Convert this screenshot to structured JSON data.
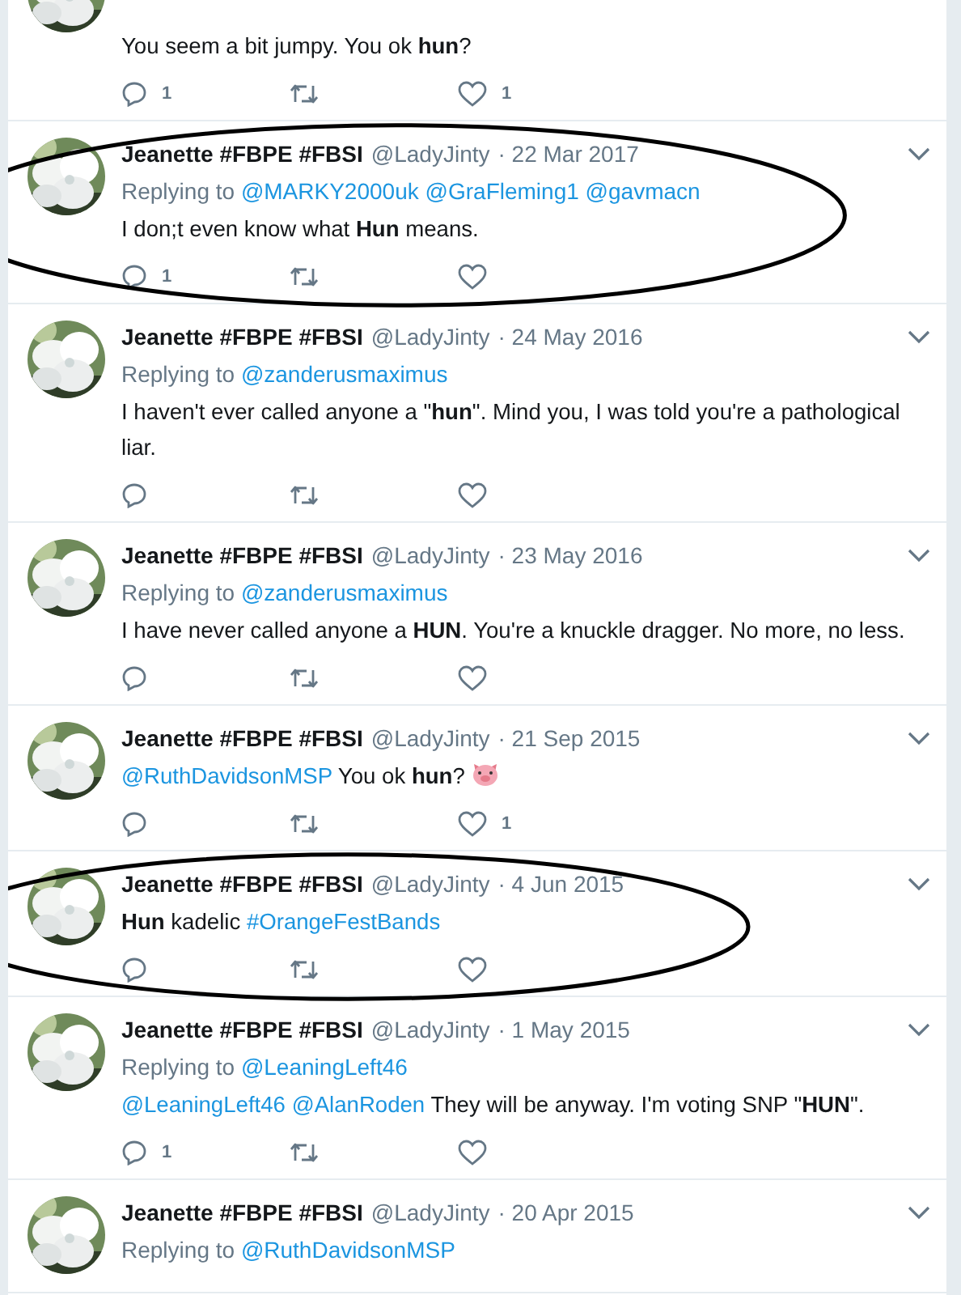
{
  "tweets": [
    {
      "partial": true,
      "circled": false,
      "body": [
        {
          "kind": "text",
          "text": "You seem a bit jumpy. You ok **hun**?"
        }
      ],
      "replies": "1",
      "likes": "1"
    },
    {
      "partial": false,
      "circled": true,
      "name": "Jeanette #FBPE #FBSI",
      "handle": "@LadyJinty",
      "date": "· 22 Mar 2017",
      "replying_label": "Replying to",
      "replying_to": [
        "@MARKY2000uk",
        "@GraFleming1",
        "@gavmacn"
      ],
      "body": [
        {
          "kind": "text",
          "text": "I don;t even know what **Hun** means."
        }
      ],
      "replies": "1"
    },
    {
      "partial": false,
      "circled": false,
      "name": "Jeanette #FBPE #FBSI",
      "handle": "@LadyJinty",
      "date": "· 24 May 2016",
      "replying_label": "Replying to",
      "replying_to": [
        "@zanderusmaximus"
      ],
      "body": [
        {
          "kind": "text",
          "text": "I haven't ever called anyone a \"**hun**\". Mind you, I was told you're a pathological liar."
        }
      ]
    },
    {
      "partial": false,
      "circled": false,
      "name": "Jeanette #FBPE #FBSI",
      "handle": "@LadyJinty",
      "date": "· 23 May 2016",
      "replying_label": "Replying to",
      "replying_to": [
        "@zanderusmaximus"
      ],
      "body": [
        {
          "kind": "text",
          "text": "I have never called anyone a **HUN**. You're a knuckle dragger. No more, no less."
        }
      ]
    },
    {
      "partial": false,
      "circled": false,
      "name": "Jeanette #FBPE #FBSI",
      "handle": "@LadyJinty",
      "date": "· 21 Sep 2015",
      "body": [
        {
          "kind": "mention",
          "text": "@RuthDavidsonMSP"
        },
        {
          "kind": "text",
          "text": " You ok **hun**? "
        },
        {
          "kind": "pig"
        }
      ],
      "likes": "1"
    },
    {
      "partial": false,
      "circled": true,
      "name": "Jeanette #FBPE #FBSI",
      "handle": "@LadyJinty",
      "date": "· 4 Jun 2015",
      "body": [
        {
          "kind": "text",
          "text": "**Hun** kadelic "
        },
        {
          "kind": "mention",
          "text": "#OrangeFestBands"
        }
      ]
    },
    {
      "partial": false,
      "circled": false,
      "name": "Jeanette #FBPE #FBSI",
      "handle": "@LadyJinty",
      "date": "· 1 May 2015",
      "replying_label": "Replying to",
      "replying_to": [
        "@LeaningLeft46"
      ],
      "body": [
        {
          "kind": "mention",
          "text": "@LeaningLeft46"
        },
        {
          "kind": "mention",
          "text": "@AlanRoden"
        },
        {
          "kind": "text",
          "text": " They will be anyway. I'm voting SNP \"**HUN**\"."
        }
      ],
      "replies": "1"
    },
    {
      "partial": false,
      "circled": false,
      "name": "Jeanette #FBPE #FBSI",
      "handle": "@LadyJinty",
      "date": "· 20 Apr 2015",
      "replying_label": "Replying to",
      "replying_to": [
        "@RuthDavidsonMSP"
      ]
    }
  ]
}
